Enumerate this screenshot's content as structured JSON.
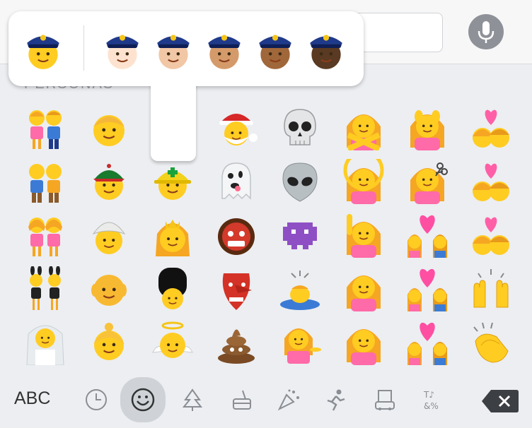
{
  "section": {
    "label": "PERSONAS"
  },
  "keyboard": {
    "abc_label": "ABC",
    "categories": [
      "recent-icon",
      "smileys-icon",
      "nature-icon",
      "food-icon",
      "celebration-icon",
      "activity-icon",
      "travel-icon",
      "symbols-icon"
    ],
    "active_category": "smileys-icon"
  },
  "popup": {
    "title": "policeman skin tone variants",
    "tones": [
      "default",
      "light",
      "medium-light",
      "medium",
      "medium-dark",
      "dark"
    ]
  },
  "emoji_rows": [
    [
      "couple",
      "man-blond",
      "(hidden)",
      "santa",
      "skull",
      "no-gesture-woman",
      "face-massage",
      "kiss-couple"
    ],
    [
      "two-men",
      "man-cap",
      "worker-helmet",
      "ghost",
      "alien",
      "ok-gesture-woman",
      "haircut",
      "kiss-couple-2"
    ],
    [
      "two-women",
      "man-turban",
      "princess",
      "ogre",
      "space-invader",
      "raising-hand",
      "couple-heart",
      "kiss-couple-3"
    ],
    [
      "bunny-girls",
      "old-man",
      "guard",
      "goblin",
      "bowing-man",
      "woman-pout",
      "couple-heart-2",
      "raising-hands"
    ],
    [
      "bride",
      "old-woman",
      "angel",
      "poop",
      "info-desk-woman",
      "frowning-woman",
      "couple-heart-3",
      "clapping-hands"
    ]
  ],
  "colors": {
    "skin_default": "#ffcc22",
    "face_shade": "#f5a623",
    "hat": "#1f3a8a",
    "pink": "#ff6aa8",
    "gray_icon": "#8a8e94"
  }
}
